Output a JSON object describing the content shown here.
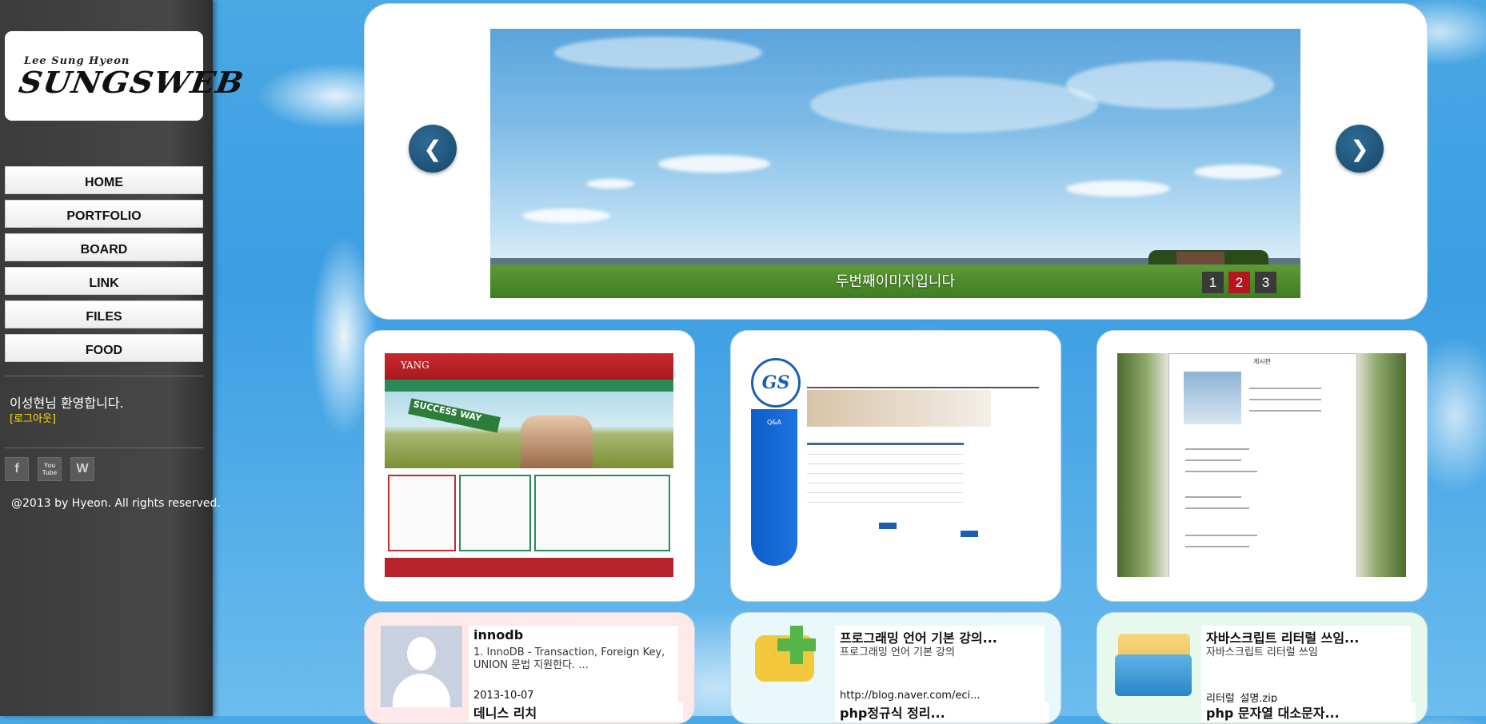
{
  "sidebar": {
    "logo_small": "Lee Sung Hyeon",
    "logo_big": "SUNGSWEB",
    "nav": [
      "HOME",
      "PORTFOLIO",
      "BOARD",
      "LINK",
      "FILES",
      "FOOD"
    ],
    "welcome": "이성현님 환영합니다.",
    "logout": "[로그아웃]",
    "social": [
      "f",
      "You Tube",
      "W"
    ],
    "copyright": "@2013 by Hyeon. All rights reserved."
  },
  "slider": {
    "caption": "두번째이미지입니다",
    "pages": [
      "1",
      "2",
      "3"
    ],
    "active_page": "2",
    "prev_label": "❮",
    "next_label": "❯"
  },
  "portfolio": [
    {
      "sign": "SUCCESS WAY",
      "logo": "YANG"
    },
    {
      "logo": "GS",
      "section": "Q&A"
    },
    {
      "title": "게시판"
    }
  ],
  "board_cards": [
    {
      "title": "innodb",
      "desc": "1. InnoDB - Transaction, Foreign Key, UNION 문법 지원한다. ...",
      "meta": "2013-10-07",
      "next_title": "데니스 리치"
    },
    {
      "title": "프로그래밍 언어 기본 강의...",
      "desc": "프로그래밍 언어 기본 강의",
      "meta": "http://blog.naver.com/eci...",
      "next_title": "php정규식 정리..."
    },
    {
      "title": "자바스크립트 리터럴 쓰임...",
      "desc": "자바스크립트 리터럴 쓰임",
      "meta": "리터럴_설명.zip",
      "next_title": "php 문자열 대소문자..."
    }
  ],
  "colors": {
    "sidebar_bg": "#3b3b3b",
    "accent_red": "#b8161e",
    "logout_yellow": "#ffe000",
    "arrow_blue": "#164869"
  }
}
